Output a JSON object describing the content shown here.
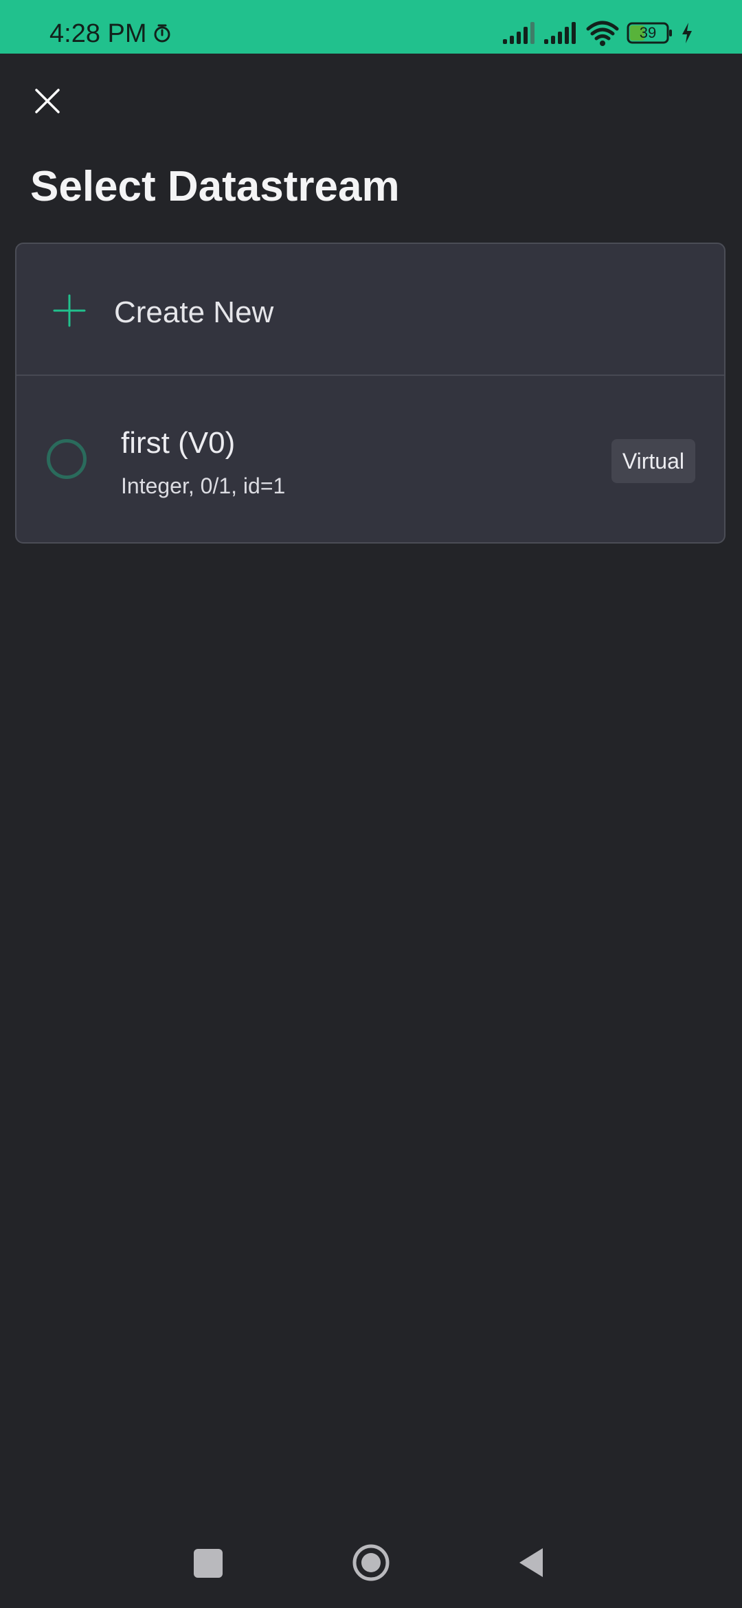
{
  "status_bar": {
    "time": "4:28 PM",
    "battery_level": "39",
    "icons": [
      "alarm-icon",
      "signal-icon",
      "signal-icon",
      "wifi-icon",
      "battery-icon",
      "charging-icon"
    ]
  },
  "header": {
    "close_icon": "close-icon",
    "title": "Select Datastream"
  },
  "list": {
    "create_new": {
      "icon": "plus-icon",
      "label": "Create New"
    },
    "items": [
      {
        "name": "first (V0)",
        "meta": "Integer, 0/1, id=1",
        "badge": "Virtual",
        "selected": false
      }
    ]
  },
  "navigation": {
    "buttons": [
      "recent-apps-button",
      "home-button",
      "back-button"
    ]
  },
  "colors": {
    "background": "#232428",
    "status_bar": "#21c18d",
    "card": "#33343e",
    "accent": "#21c18d",
    "radio_border": "#2a6b5c"
  }
}
